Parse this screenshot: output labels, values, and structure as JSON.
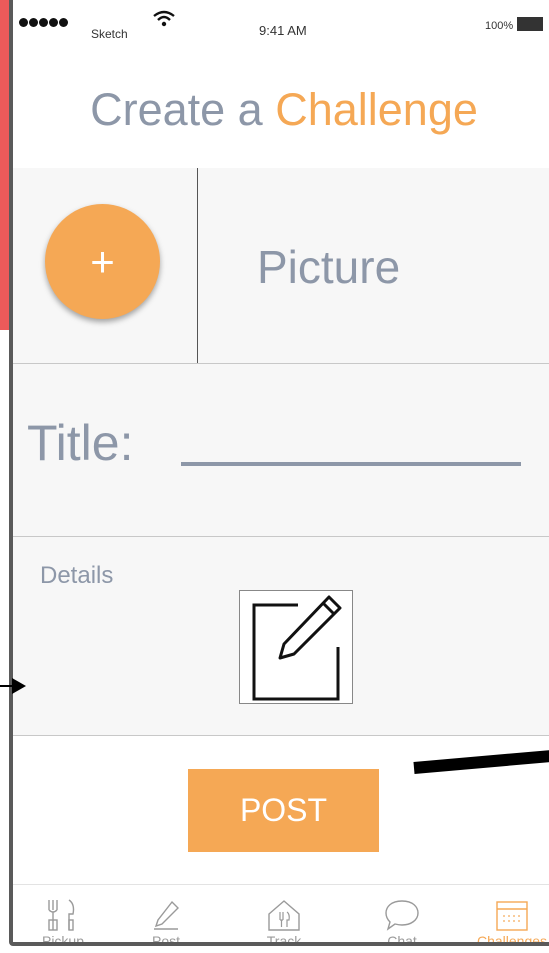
{
  "status_bar": {
    "carrier": "Sketch",
    "time": "9:41 AM",
    "battery": "100%"
  },
  "header": {
    "title_part1": "Create a ",
    "title_part2": "Challenge"
  },
  "picture": {
    "add_label": "+",
    "label": "Picture"
  },
  "title_field": {
    "label": "Title:"
  },
  "details": {
    "label": "Details"
  },
  "post_button": "POST",
  "tabs": [
    {
      "label": "Pickup",
      "icon": "utensils-icon",
      "active": false
    },
    {
      "label": "Post",
      "icon": "pencil-icon",
      "active": false
    },
    {
      "label": "Track",
      "icon": "home-utensils-icon",
      "active": false
    },
    {
      "label": "Chat",
      "icon": "chat-bubble-icon",
      "active": false
    },
    {
      "label": "Challenges",
      "icon": "calendar-icon",
      "active": true
    }
  ],
  "colors": {
    "accent": "#f5a855",
    "text_grey": "#8d97a8",
    "frame": "#5a5a5a",
    "red_strip": "#ec5a5a"
  }
}
